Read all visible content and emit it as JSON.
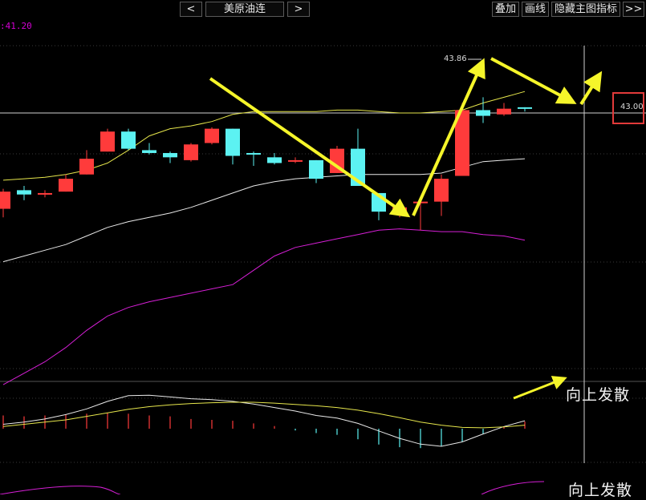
{
  "toolbar": {
    "prev_label": "<",
    "symbol": "美原油连",
    "next_label": ">",
    "overlay_label": "叠加",
    "draw_label": "画线",
    "hide_indicator_label": "隐藏主图指标",
    "more_label": ">>"
  },
  "price_tag": ":41.20",
  "high_label": "43.86",
  "right_price_label": "43.00",
  "annotations": {
    "upper": "向上发散",
    "lower": "向上发散"
  },
  "colors": {
    "up": "#ff3b3b",
    "down": "#5cf2f2",
    "upper_band": "#e6e64c",
    "mid_band": "#e8e8e8",
    "lower_band": "#d61fd6",
    "arrow": "#f5f52a",
    "highlight_box": "#e23a3a"
  },
  "chart_data": {
    "type": "candlestick",
    "title": "美原油连",
    "candles": [
      {
        "open": 39.65,
        "high": 40.35,
        "low": 39.35,
        "close": 40.25
      },
      {
        "open": 40.3,
        "high": 40.45,
        "low": 39.95,
        "close": 40.15
      },
      {
        "open": 40.2,
        "high": 40.3,
        "low": 40.05,
        "close": 40.2
      },
      {
        "open": 40.25,
        "high": 40.85,
        "low": 40.25,
        "close": 40.7
      },
      {
        "open": 40.85,
        "high": 41.7,
        "low": 40.85,
        "close": 41.4
      },
      {
        "open": 41.65,
        "high": 42.45,
        "low": 41.65,
        "close": 42.35
      },
      {
        "open": 42.35,
        "high": 42.45,
        "low": 41.7,
        "close": 41.75
      },
      {
        "open": 41.7,
        "high": 41.95,
        "low": 41.55,
        "close": 41.6
      },
      {
        "open": 41.6,
        "high": 41.65,
        "low": 41.25,
        "close": 41.45
      },
      {
        "open": 41.35,
        "high": 41.95,
        "low": 41.3,
        "close": 41.9
      },
      {
        "open": 41.95,
        "high": 42.5,
        "low": 41.9,
        "close": 42.45
      },
      {
        "open": 42.45,
        "high": 42.45,
        "low": 41.2,
        "close": 41.5
      },
      {
        "open": 41.6,
        "high": 41.65,
        "low": 41.15,
        "close": 41.55
      },
      {
        "open": 41.45,
        "high": 41.6,
        "low": 41.2,
        "close": 41.25
      },
      {
        "open": 41.3,
        "high": 41.45,
        "low": 41.25,
        "close": 41.35
      },
      {
        "open": 41.35,
        "high": 41.35,
        "low": 40.55,
        "close": 40.7
      },
      {
        "open": 40.9,
        "high": 41.85,
        "low": 40.9,
        "close": 41.75
      },
      {
        "open": 41.75,
        "high": 42.45,
        "low": 40.45,
        "close": 40.45
      },
      {
        "open": 40.2,
        "high": 40.2,
        "low": 39.25,
        "close": 39.55
      },
      {
        "open": 39.5,
        "high": 39.7,
        "low": 39.35,
        "close": 39.7
      },
      {
        "open": 39.85,
        "high": 39.9,
        "low": 38.9,
        "close": 39.9
      },
      {
        "open": 39.9,
        "high": 40.85,
        "low": 39.4,
        "close": 40.7
      },
      {
        "open": 40.8,
        "high": 43.35,
        "low": 40.8,
        "close": 43.1
      },
      {
        "open": 43.1,
        "high": 43.55,
        "low": 42.65,
        "close": 42.9
      },
      {
        "open": 42.95,
        "high": 43.35,
        "low": 42.9,
        "close": 43.15
      },
      {
        "open": 43.2,
        "high": 43.2,
        "low": 43.05,
        "close": 43.15
      }
    ],
    "bands": {
      "upper": [
        40.65,
        40.7,
        40.75,
        40.85,
        41.0,
        41.25,
        41.7,
        42.2,
        42.45,
        42.55,
        42.7,
        42.95,
        43.05,
        43.05,
        43.05,
        43.05,
        43.1,
        43.1,
        43.05,
        43.0,
        43.0,
        43.05,
        43.1,
        43.35,
        43.55,
        43.75
      ],
      "mid": [
        37.8,
        38.0,
        38.2,
        38.4,
        38.7,
        39.0,
        39.2,
        39.35,
        39.5,
        39.7,
        39.95,
        40.2,
        40.45,
        40.6,
        40.7,
        40.75,
        40.8,
        40.85,
        40.85,
        40.85,
        40.85,
        40.9,
        41.1,
        41.3,
        41.35,
        41.4
      ],
      "lower": [
        33.5,
        33.9,
        34.3,
        34.8,
        35.4,
        35.9,
        36.2,
        36.4,
        36.55,
        36.7,
        36.85,
        37.0,
        37.5,
        38.0,
        38.3,
        38.45,
        38.6,
        38.75,
        38.9,
        38.95,
        38.9,
        38.85,
        38.85,
        38.75,
        38.7,
        38.55
      ]
    },
    "macd": {
      "dif": [
        0.1,
        0.15,
        0.22,
        0.32,
        0.45,
        0.62,
        0.75,
        0.76,
        0.72,
        0.68,
        0.66,
        0.62,
        0.56,
        0.48,
        0.4,
        0.3,
        0.24,
        0.12,
        -0.05,
        -0.22,
        -0.35,
        -0.4,
        -0.3,
        -0.12,
        0.05,
        0.18
      ],
      "dea": [
        0.05,
        0.1,
        0.15,
        0.2,
        0.28,
        0.36,
        0.44,
        0.5,
        0.54,
        0.57,
        0.59,
        0.6,
        0.6,
        0.58,
        0.55,
        0.52,
        0.48,
        0.42,
        0.34,
        0.25,
        0.15,
        0.08,
        0.03,
        0.02,
        0.04,
        0.08
      ],
      "hist": [
        0.3,
        0.28,
        0.3,
        0.32,
        0.34,
        0.36,
        0.34,
        0.3,
        0.28,
        0.22,
        0.2,
        0.18,
        0.12,
        0.06,
        -0.04,
        -0.1,
        -0.14,
        -0.24,
        -0.36,
        -0.42,
        -0.44,
        -0.4,
        -0.3,
        -0.12,
        0.05,
        0.16
      ]
    }
  }
}
